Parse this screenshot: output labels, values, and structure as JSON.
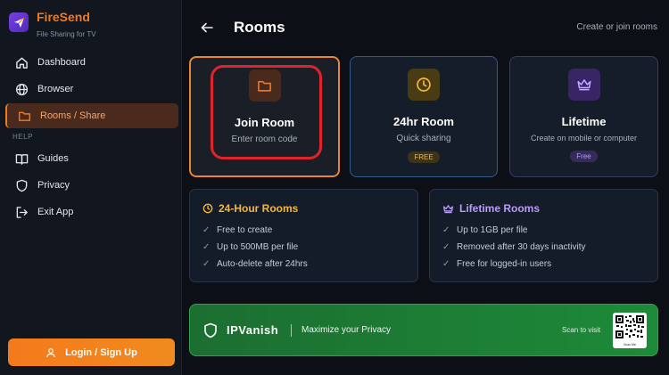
{
  "app": {
    "name": "FireSend",
    "tagline": "File Sharing for TV"
  },
  "sidebar": {
    "items": [
      {
        "label": "Dashboard",
        "icon": "home-icon"
      },
      {
        "label": "Browser",
        "icon": "globe-icon"
      },
      {
        "label": "Rooms / Share",
        "icon": "folder-icon",
        "active": true
      }
    ],
    "help_label": "HELP",
    "help_items": [
      {
        "label": "Guides",
        "icon": "book-icon"
      },
      {
        "label": "Privacy",
        "icon": "shield-icon"
      },
      {
        "label": "Exit App",
        "icon": "exit-icon"
      }
    ],
    "login_label": "Login / Sign Up"
  },
  "header": {
    "title": "Rooms",
    "subtitle": "Create or join rooms"
  },
  "cards": {
    "join": {
      "title": "Join Room",
      "desc": "Enter room code"
    },
    "hour24": {
      "title": "24hr Room",
      "desc": "Quick sharing",
      "badge": "FREE"
    },
    "lifetime": {
      "title": "Lifetime",
      "desc": "Create on mobile or computer",
      "badge": "Free"
    }
  },
  "panels": {
    "hour24": {
      "title": "24-Hour Rooms",
      "features": [
        "Free to create",
        "Up to 500MB per file",
        "Auto-delete after 24hrs"
      ]
    },
    "lifetime": {
      "title": "Lifetime Rooms",
      "features": [
        "Up to 1GB per file",
        "Removed after 30 days inactivity",
        "Free for logged-in users"
      ]
    }
  },
  "ad": {
    "brand": "IPVanish",
    "tagline": "Maximize your Privacy",
    "cta": "Scan to visit",
    "qr_caption": "Scan Me"
  },
  "colors": {
    "accent": "#f07a1f",
    "background": "#0c0f15",
    "sidebar": "#11161f",
    "gold": "#f3b63d",
    "purple": "#b99cf6",
    "ad_green": "#1d8a39",
    "highlight_red": "#e0222b"
  }
}
